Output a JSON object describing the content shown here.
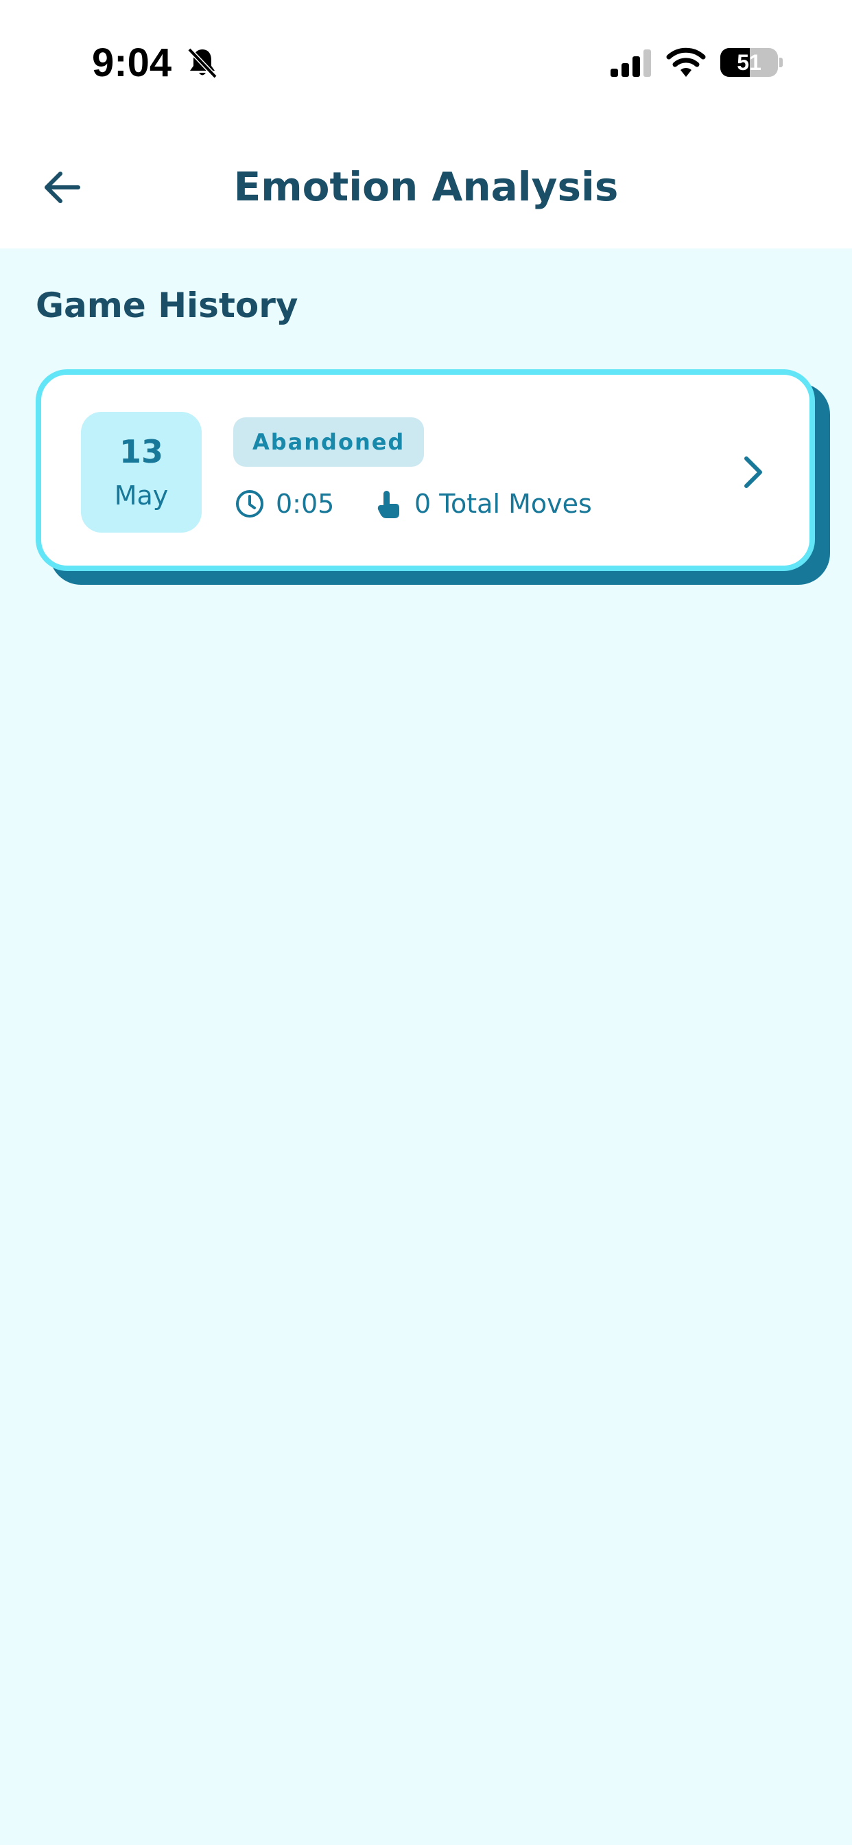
{
  "status_bar": {
    "time": "9:04",
    "battery_level": "51",
    "battery_fraction": 0.51,
    "icons": [
      "bell-slash-icon",
      "cellular-signal-icon",
      "wifi-icon",
      "battery-icon"
    ]
  },
  "header": {
    "title": "Emotion Analysis",
    "back_icon": "arrow-left-icon"
  },
  "section": {
    "title": "Game History"
  },
  "history": [
    {
      "day": "13",
      "month": "May",
      "status": "Abandoned",
      "duration": "0:05",
      "moves": "0 Total Moves",
      "duration_icon": "clock-icon",
      "moves_icon": "tap-hand-icon",
      "open_icon": "chevron-right-icon"
    }
  ],
  "colors": {
    "background": "#eafcfe",
    "primary_text": "#1b4f68",
    "accent": "#187899",
    "card_border": "#62e5f7",
    "date_tile": "#bff2fb",
    "badge_bg": "#cce9f1"
  }
}
